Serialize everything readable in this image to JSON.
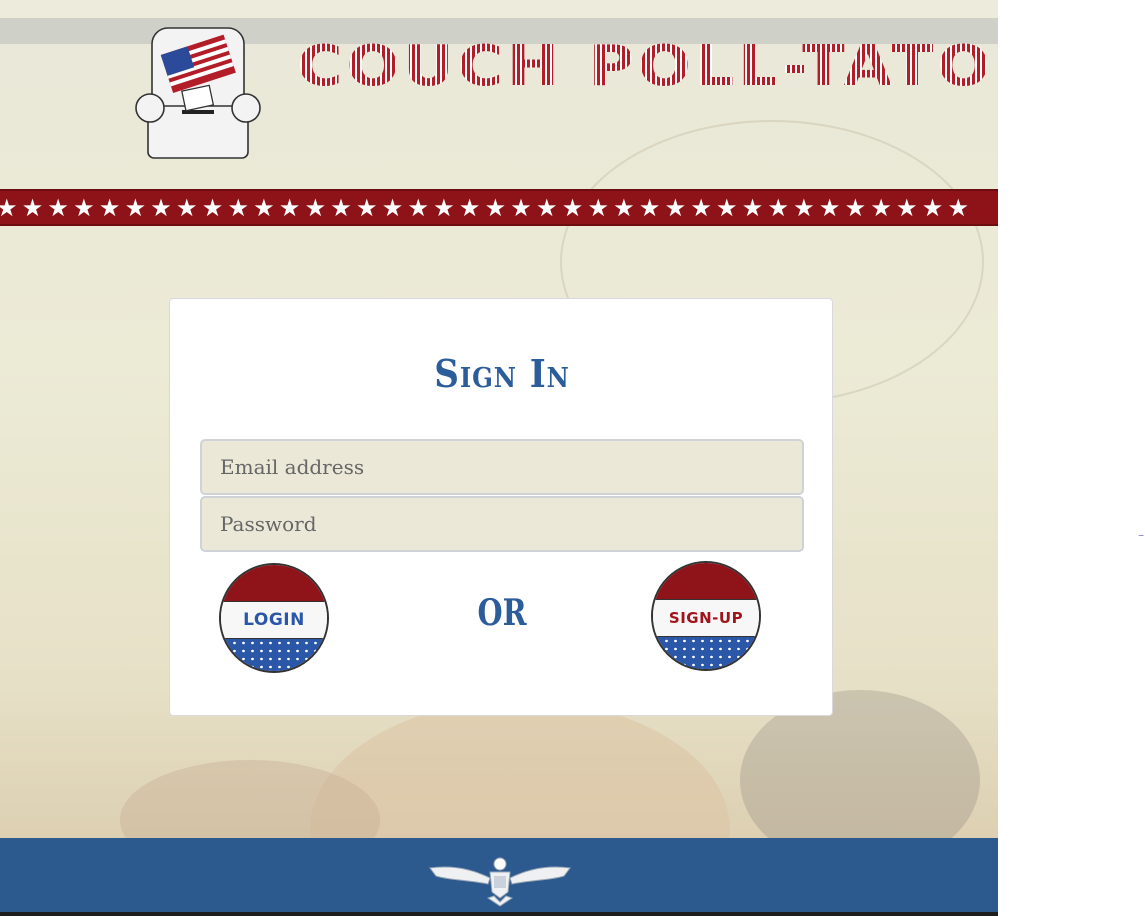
{
  "header": {
    "site_title": "COUCH POLL-TATO",
    "logo_icon": "armchair-ballot-box-icon",
    "banner_stars": "★★★★★★★★★★★★★★★★★★★★★★★★★★★★★★★★★★★★★★"
  },
  "signin": {
    "title": "Sign In",
    "email_placeholder": "Email address",
    "password_placeholder": "Password",
    "login_label": "LOGIN",
    "or_label": "OR",
    "signup_label": "SIGN-UP"
  },
  "footer": {
    "emblem_icon": "eagle-emblem-icon"
  },
  "colors": {
    "brand_red": "#8f1419",
    "brand_blue": "#2c5a8f",
    "title_blue": "#2c5d9b",
    "background": "#ecebd6"
  }
}
